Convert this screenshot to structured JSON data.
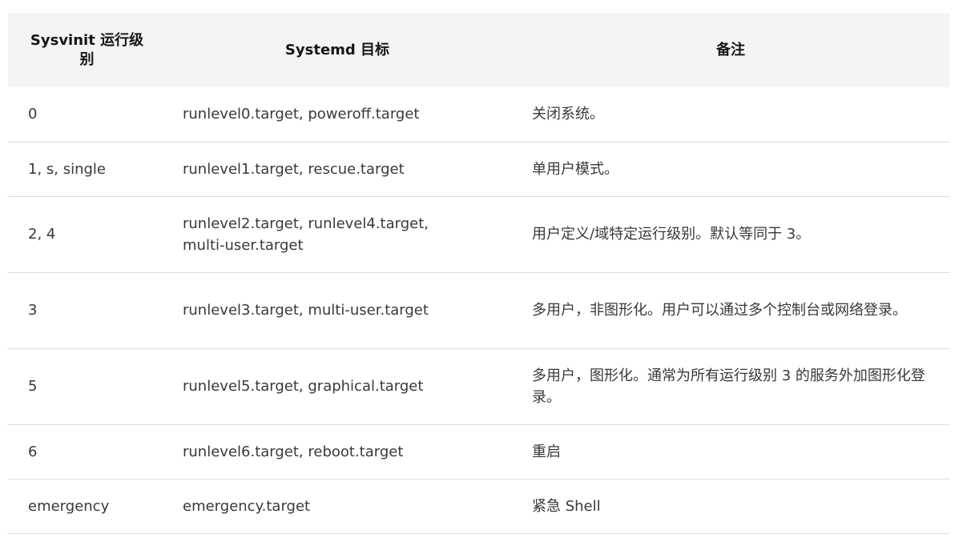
{
  "table": {
    "headers": {
      "sysvinit": "Sysvinit 运行级别",
      "systemd": "Systemd 目标",
      "note": "备注"
    },
    "rows": [
      {
        "sysvinit": "0",
        "systemd": "runlevel0.target, poweroff.target",
        "note": "关闭系统。"
      },
      {
        "sysvinit": "1, s, single",
        "systemd": "runlevel1.target, rescue.target",
        "note": "单用户模式。"
      },
      {
        "sysvinit": "2, 4",
        "systemd": "runlevel2.target, runlevel4.target, multi-user.target",
        "note": "用户定义/域特定运行级别。默认等同于 3。"
      },
      {
        "sysvinit": "3",
        "systemd": "runlevel3.target, multi-user.target",
        "note": "多用户，非图形化。用户可以通过多个控制台或网络登录。"
      },
      {
        "sysvinit": "5",
        "systemd": "runlevel5.target, graphical.target",
        "note": "多用户，图形化。通常为所有运行级别 3 的服务外加图形化登录。"
      },
      {
        "sysvinit": "6",
        "systemd": "runlevel6.target, reboot.target",
        "note": "重启"
      },
      {
        "sysvinit": "emergency",
        "systemd": "emergency.target",
        "note": "紧急 Shell"
      }
    ]
  }
}
